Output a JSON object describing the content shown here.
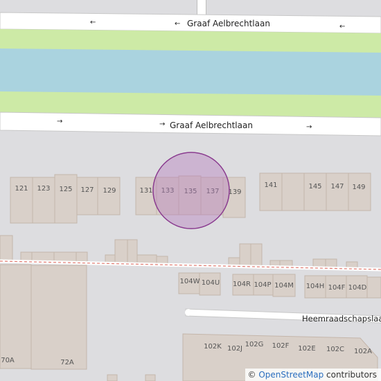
{
  "colors": {
    "background": "#dddde0",
    "road": "#ffffff",
    "water": "#aad3df",
    "grass": "#cdeaa6",
    "building": "#d9d0c9",
    "building_outline": "#c4b6ab",
    "marker_fill": "#b47dbd",
    "marker_stroke": "#8a3b8f",
    "railway_dash": "#e07a70"
  },
  "streets": {
    "top_street": "Graaf Aelbrechtlaan",
    "middle_street": "Graaf Aelbrechtlaan",
    "bottom_street": "Heemraadschapslaan"
  },
  "one_way_arrows": {
    "west": "←",
    "east": "→"
  },
  "house_numbers": {
    "row_upper": [
      "121",
      "123",
      "125",
      "127",
      "129",
      "131",
      "133",
      "135",
      "137",
      "139",
      "141",
      "145",
      "147",
      "149"
    ],
    "row_middle": [
      "104W",
      "104U",
      "104R",
      "104P",
      "104M",
      "104H",
      "104F",
      "104D"
    ],
    "row_lower": [
      "102K",
      "102J",
      "102G",
      "102F",
      "102E",
      "102C",
      "102A"
    ],
    "row_left": [
      "70A",
      "72A"
    ]
  },
  "attribution": {
    "copyright_symbol": "©",
    "link_text": "OpenStreetMap",
    "suffix": "contributors"
  }
}
